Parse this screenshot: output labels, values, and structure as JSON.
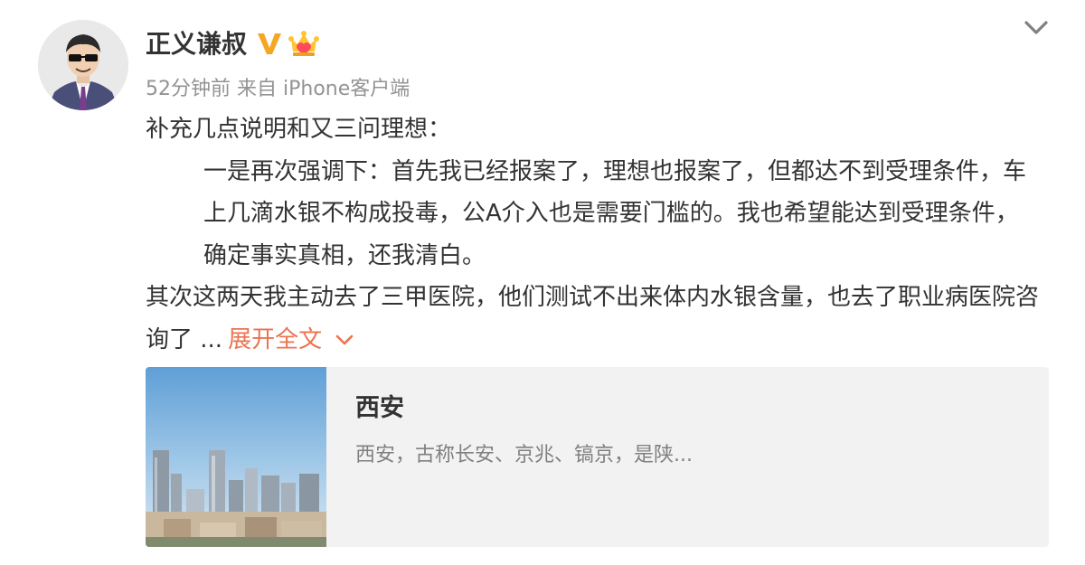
{
  "post": {
    "author": "正义谦叔",
    "time": "52分钟前",
    "source": "来自 iPhone客户端",
    "paragraphs": [
      "补充几点说明和又三问理想：",
      "一是再次强调下：首先我已经报案了，理想也报案了，但都达不到受理条件，车上几滴水银不构成投毒，公A介入也是需要门槛的。我也希望能达到受理条件，确定事实真相，还我清白。",
      "其次这两天我主动去了三甲医院，他们测试不出来体内水银含量，也去了职业病医院咨询了 ..."
    ],
    "expand_label": "展开全文"
  },
  "card": {
    "title": "西安",
    "description": "西安，古称长安、京兆、镐京，是陕..."
  },
  "colors": {
    "accent": "#eb7350",
    "verified_badge": "#f5a623",
    "card_bg": "#f2f2f2",
    "meta_text": "#939393"
  },
  "icons": {
    "verified": "verified-v-icon",
    "member": "crown-member-icon",
    "menu": "chevron-down-icon",
    "expand": "chevron-down-icon"
  }
}
